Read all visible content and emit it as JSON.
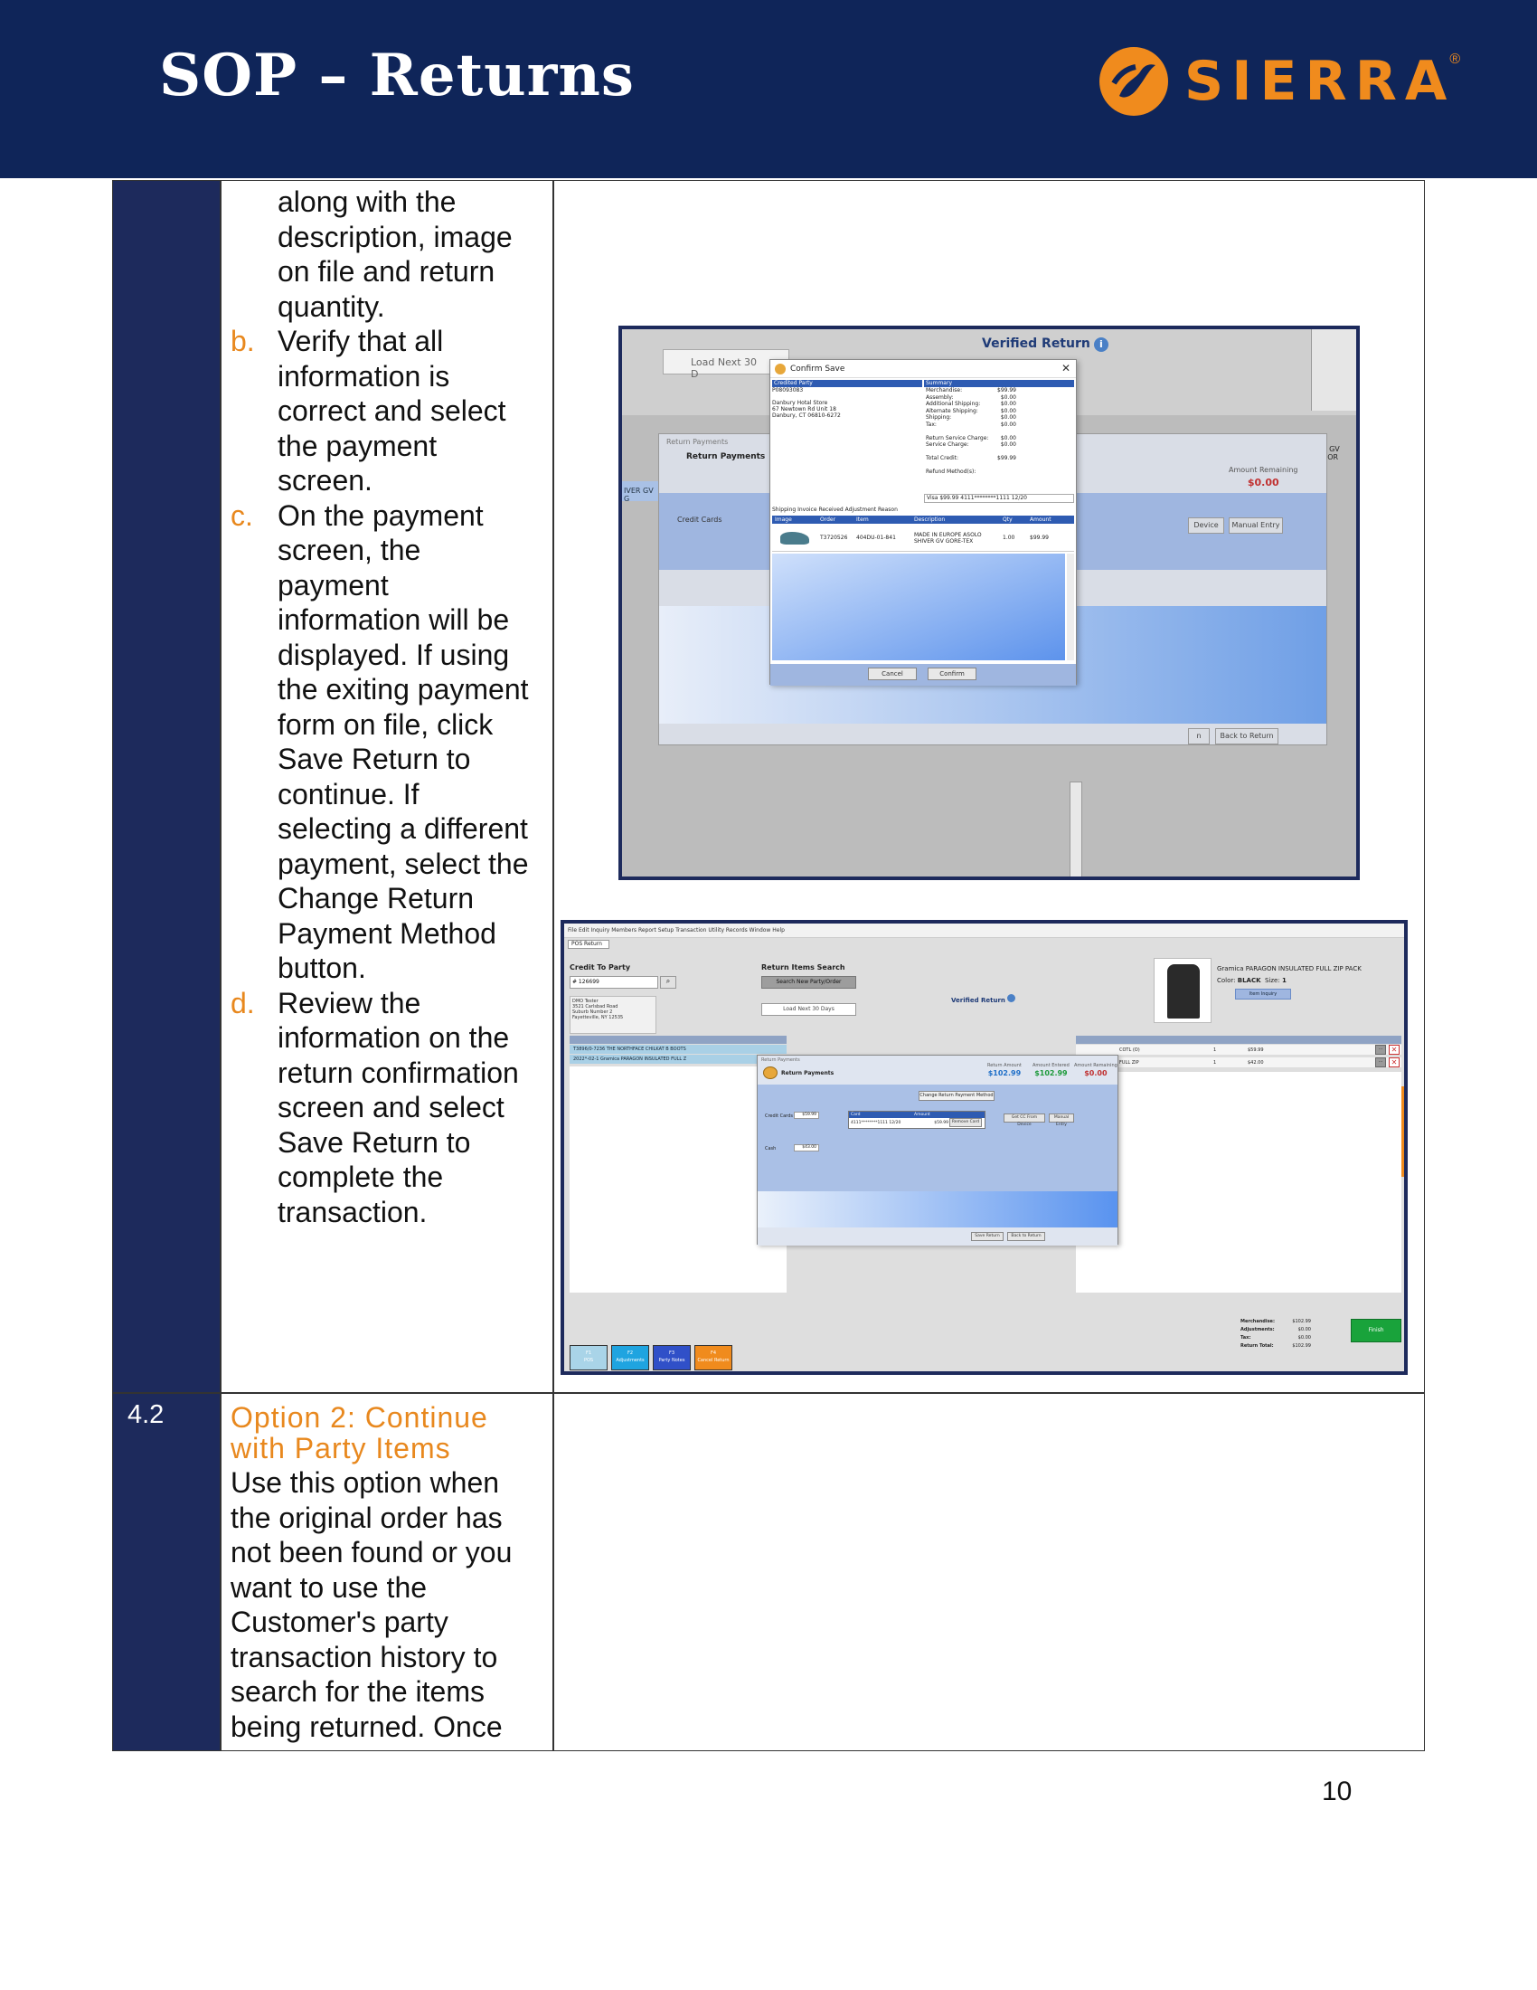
{
  "header": {
    "title": "SOP – Returns",
    "logo_text": "SIERRA",
    "logo_reg": "®",
    "bg_color": "#0f2559",
    "accent_color": "#f08b1d"
  },
  "row1": {
    "continuation_lines": [
      "along with the",
      "description, image",
      "on file and return",
      "quantity."
    ],
    "items": [
      {
        "letter": "b.",
        "lines": [
          "Verify that all",
          "information is",
          "correct and select",
          "the payment",
          "screen."
        ]
      },
      {
        "letter": "c.",
        "lines": [
          "On the payment",
          "screen, the",
          "payment",
          "information will be",
          "displayed. If using",
          "the exiting payment",
          "form on file, click",
          "Save Return to",
          "continue. If",
          "selecting a different",
          "payment, select the",
          "Change Return",
          "Payment Method",
          "button."
        ]
      },
      {
        "letter": "d.",
        "lines": [
          "Review the",
          "information on the",
          "return confirmation",
          "screen and select",
          "Save Return to",
          "complete the",
          "transaction."
        ]
      }
    ]
  },
  "row2": {
    "number": "4.2",
    "title_lines": [
      "Option 2: Continue",
      "with Party Items"
    ],
    "body_lines": [
      "Use this option when",
      "the original order has",
      "not been found or you",
      "want to use the",
      "Customer's party",
      "transaction history to",
      "search for the items",
      "being returned. Once"
    ]
  },
  "page_number": "10",
  "screenshot1": {
    "load_next": "Load Next 30 D",
    "verified_return": "Verified Return",
    "return_payments_title": "Return Payments",
    "return_payments_head": "Return Payments",
    "amount_remaining_label": "Amount Remaining",
    "amount_remaining_value": "$0.00",
    "credit_cards_label": "Credit Cards",
    "gv_tag": "IVER GV G",
    "gv_tag_right": "R GV GOR",
    "side_buttons": [
      "Device",
      "Manual Entry",
      "n",
      "Back to Return"
    ],
    "confirm_save": {
      "title": "Confirm Save",
      "credited_party_label": "Credited Party",
      "party_lines": [
        "P08093083",
        "",
        "Danbury Hotal Store",
        "67 Newtown Rd Unit 18",
        "Danbury, CT 06810-6272"
      ],
      "summary_label": "Summary",
      "summary_rows": [
        [
          "Merchandise:",
          "$99.99"
        ],
        [
          "Assembly:",
          "$0.00"
        ],
        [
          "Additional Shipping:",
          "$0.00"
        ],
        [
          "Alternate Shipping:",
          "$0.00"
        ],
        [
          "Shipping:",
          "$0.00"
        ],
        [
          "Tax:",
          "$0.00"
        ],
        [
          "",
          ""
        ],
        [
          "Return Service Charge:",
          "$0.00"
        ],
        [
          "Service Charge:",
          "$0.00"
        ],
        [
          "",
          ""
        ],
        [
          "Total Credit:",
          "$99.99"
        ],
        [
          "",
          ""
        ],
        [
          "Refund Method(s):",
          ""
        ]
      ],
      "visa_line": "Visa          $99.99  4111********1111 12/20",
      "shipping_bar": "Shipping Invoice Received Adjustment Reason",
      "grid_headers": [
        "Image",
        "Order",
        "Item",
        "Description",
        "Qty",
        "Amount"
      ],
      "grid_row": {
        "order": "T3720526",
        "item": "404DU-01-841",
        "description": "MADE IN EUROPE ASOLO SHIVER GV GORE-TEX",
        "qty": "1.00",
        "amount": "$99.99"
      },
      "cancel": "Cancel",
      "confirm": "Confirm"
    }
  },
  "screenshot2": {
    "menu": "File  Edit  Inquiry  Members  Report  Setup  Transaction  Utility  Records  Window  Help",
    "tab": "POS Return",
    "credit_to_party": "Credit To Party",
    "search_value": "# 126699",
    "party_card_lines": [
      "DMO Tester",
      "3521 Carlsbad Road",
      "Suburb Number 2",
      "Fayetteville, NY 12535"
    ],
    "return_items_search": "Return Items Search",
    "search_new_party": "Search New Party/Order",
    "load_next_30": "Load Next 30 Days",
    "verified_return": "Verified Return",
    "product_name": "Gramica PARAGON INSULATED FULL ZIP PACK",
    "product_color_label": "Color:",
    "product_color": "BLACK",
    "product_size_label": "Size:",
    "product_size": "1",
    "item_inquiry": "Item Inquiry",
    "left_rows": [
      "T3896/0-7236          THE NORTHFACE CHILKAT B BOOTS",
      "2022*-02-1              Gramica PARAGON INSULATED FULL Z"
    ],
    "right_rows": [
      {
        "desc": "COTL (O)",
        "qty": "1",
        "amount": "$59.99"
      },
      {
        "desc": "FULL ZIP",
        "qty": "1",
        "amount": "$42.00"
      }
    ],
    "return_payments": {
      "title": "Return Payments",
      "head": "Return Payments",
      "return_amount_label": "Return Amount",
      "return_amount": "$102.99",
      "amount_entered_label": "Amount Entered",
      "amount_entered": "$102.99",
      "amount_remaining_label": "Amount Remaining",
      "amount_remaining": "$0.00",
      "change_method": "Change Return Payment Method",
      "credit_cards_label": "Credit Cards",
      "credit_cards_value": "$59.99",
      "card_headers": [
        "Card",
        "Amount"
      ],
      "card_row": [
        "4111********1111 12/20",
        "$59.99"
      ],
      "remove_card": "Remove Card",
      "card_device": "Get CC From Device",
      "manual_entry": "Manual Entry",
      "cash_label": "Cash",
      "cash_value": "$43.00",
      "save_return": "Save Return",
      "back_to_return": "Back to Return"
    },
    "totals": [
      [
        "Merchandise:",
        "$102.99"
      ],
      [
        "Adjustments:",
        "$0.00"
      ],
      [
        "Tax:",
        "$0.00"
      ],
      [
        "Return Total:",
        "$102.99"
      ]
    ],
    "finish": "Finish",
    "fkeys": [
      {
        "key": "F1",
        "label": "POS",
        "color": "#a9d4e8"
      },
      {
        "key": "F2",
        "label": "Adjustments",
        "color": "#1fa4e0"
      },
      {
        "key": "F3",
        "label": "Party Notes",
        "color": "#3050c8"
      },
      {
        "key": "F4",
        "label": "Cancel Return",
        "color": "#f08b1d"
      }
    ]
  }
}
